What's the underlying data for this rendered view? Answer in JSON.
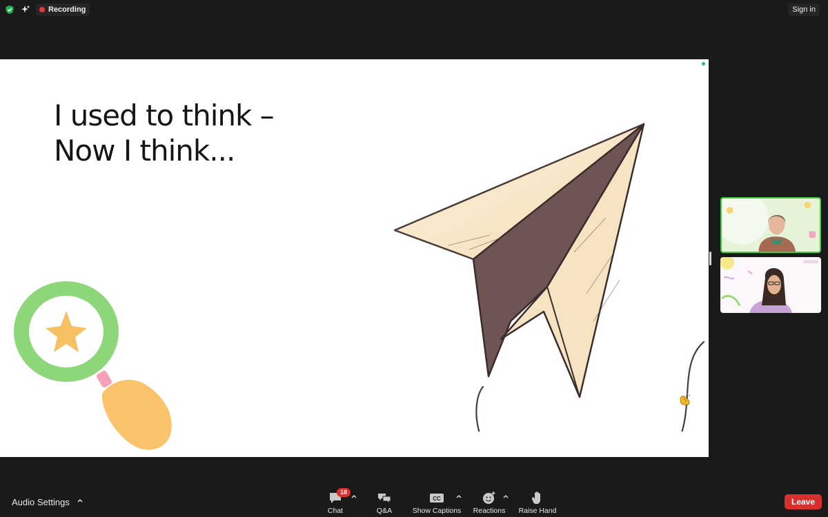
{
  "top_bar": {
    "recording_label": "Recording",
    "sign_in_label": "Sign in"
  },
  "slide": {
    "title_line_1": "I used to think –",
    "title_line_2": "Now I think..."
  },
  "participants": [
    {
      "active_speaker": true
    },
    {
      "active_speaker": false
    }
  ],
  "bottom_bar": {
    "audio_settings_label": "Audio Settings",
    "chat_label": "Chat",
    "chat_badge": "18",
    "qa_label": "Q&A",
    "captions_label": "Show Captions",
    "captions_icon_text": "CC",
    "reactions_label": "Reactions",
    "raise_hand_label": "Raise Hand",
    "leave_label": "Leave"
  },
  "colors": {
    "recording_dot": "#e5383b",
    "leave_button": "#d72e2e",
    "active_speaker_border": "#3ccf3c",
    "badge": "#e02d2d"
  },
  "icons": [
    "shield-check-icon",
    "sparkle-icon",
    "chat-icon",
    "qa-icon",
    "captions-icon",
    "reactions-icon",
    "raise-hand-icon",
    "chevron-up-icon"
  ]
}
